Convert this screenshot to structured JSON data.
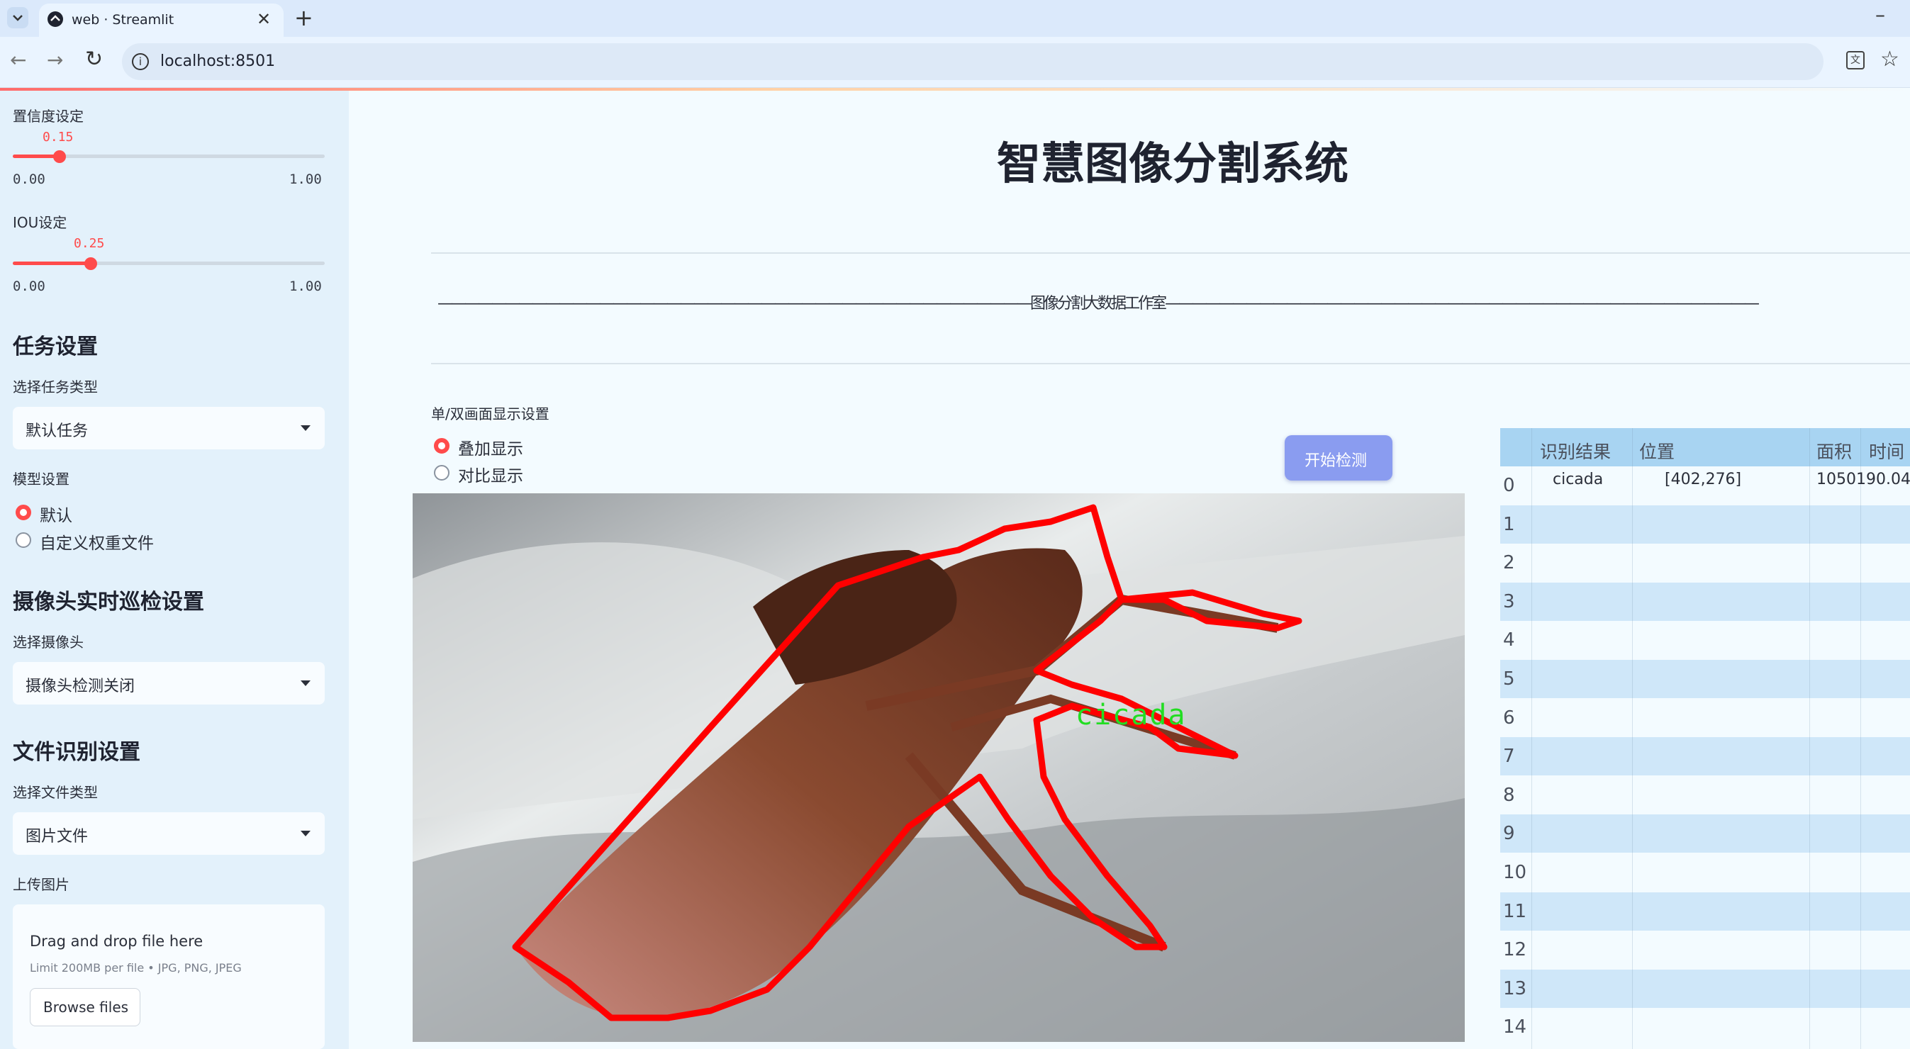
{
  "browser": {
    "tab_title": "web · Streamlit",
    "url": "localhost:8501"
  },
  "sidebar": {
    "confidence": {
      "label": "置信度设定",
      "value": "0.15",
      "value_fraction": 0.15,
      "min": "0.00",
      "max": "1.00"
    },
    "iou": {
      "label": "IOU设定",
      "value": "0.25",
      "value_fraction": 0.25,
      "min": "0.00",
      "max": "1.00"
    },
    "task_header": "任务设置",
    "task_type_label": "选择任务类型",
    "task_type_value": "默认任务",
    "model_label": "模型设置",
    "model_options": [
      "默认",
      "自定义权重文件"
    ],
    "model_selected": "默认",
    "camera_header": "摄像头实时巡检设置",
    "camera_label": "选择摄像头",
    "camera_value": "摄像头检测关闭",
    "file_header": "文件识别设置",
    "file_type_label": "选择文件类型",
    "file_type_value": "图片文件",
    "upload_label": "上传图片",
    "upload_drop_text": "Drag and drop file here",
    "upload_limit_text": "Limit 200MB per file • JPG, PNG, JPEG",
    "browse_button": "Browse files"
  },
  "main": {
    "title": "智慧图像分割系统",
    "studio_line": "————————————————————————————————————————————图像分割大数据工作室————————————————————————————————————————————",
    "display_label": "单/双画面显示设置",
    "display_options": [
      "叠加显示",
      "对比显示"
    ],
    "display_selected": "叠加显示",
    "start_button": "开始检测",
    "detection_label": "cicada"
  },
  "table": {
    "columns": [
      "识别结果",
      "位置",
      "面积",
      "时间"
    ],
    "rows": [
      {
        "index": "0",
        "result": "cicada",
        "position": "[402,276]",
        "area": "1050190.04"
      },
      {
        "index": "1"
      },
      {
        "index": "2"
      },
      {
        "index": "3"
      },
      {
        "index": "4"
      },
      {
        "index": "5"
      },
      {
        "index": "6"
      },
      {
        "index": "7"
      },
      {
        "index": "8"
      },
      {
        "index": "9"
      },
      {
        "index": "10"
      },
      {
        "index": "11"
      },
      {
        "index": "12"
      },
      {
        "index": "13"
      },
      {
        "index": "14"
      }
    ]
  },
  "colors": {
    "accent": "#ff4b4b",
    "button": "#8a9cf0",
    "table_header": "#a8d4f2",
    "table_stripe": "#cfe7f9",
    "mask_outline": "#ff0000",
    "label_green": "#22dd22"
  }
}
